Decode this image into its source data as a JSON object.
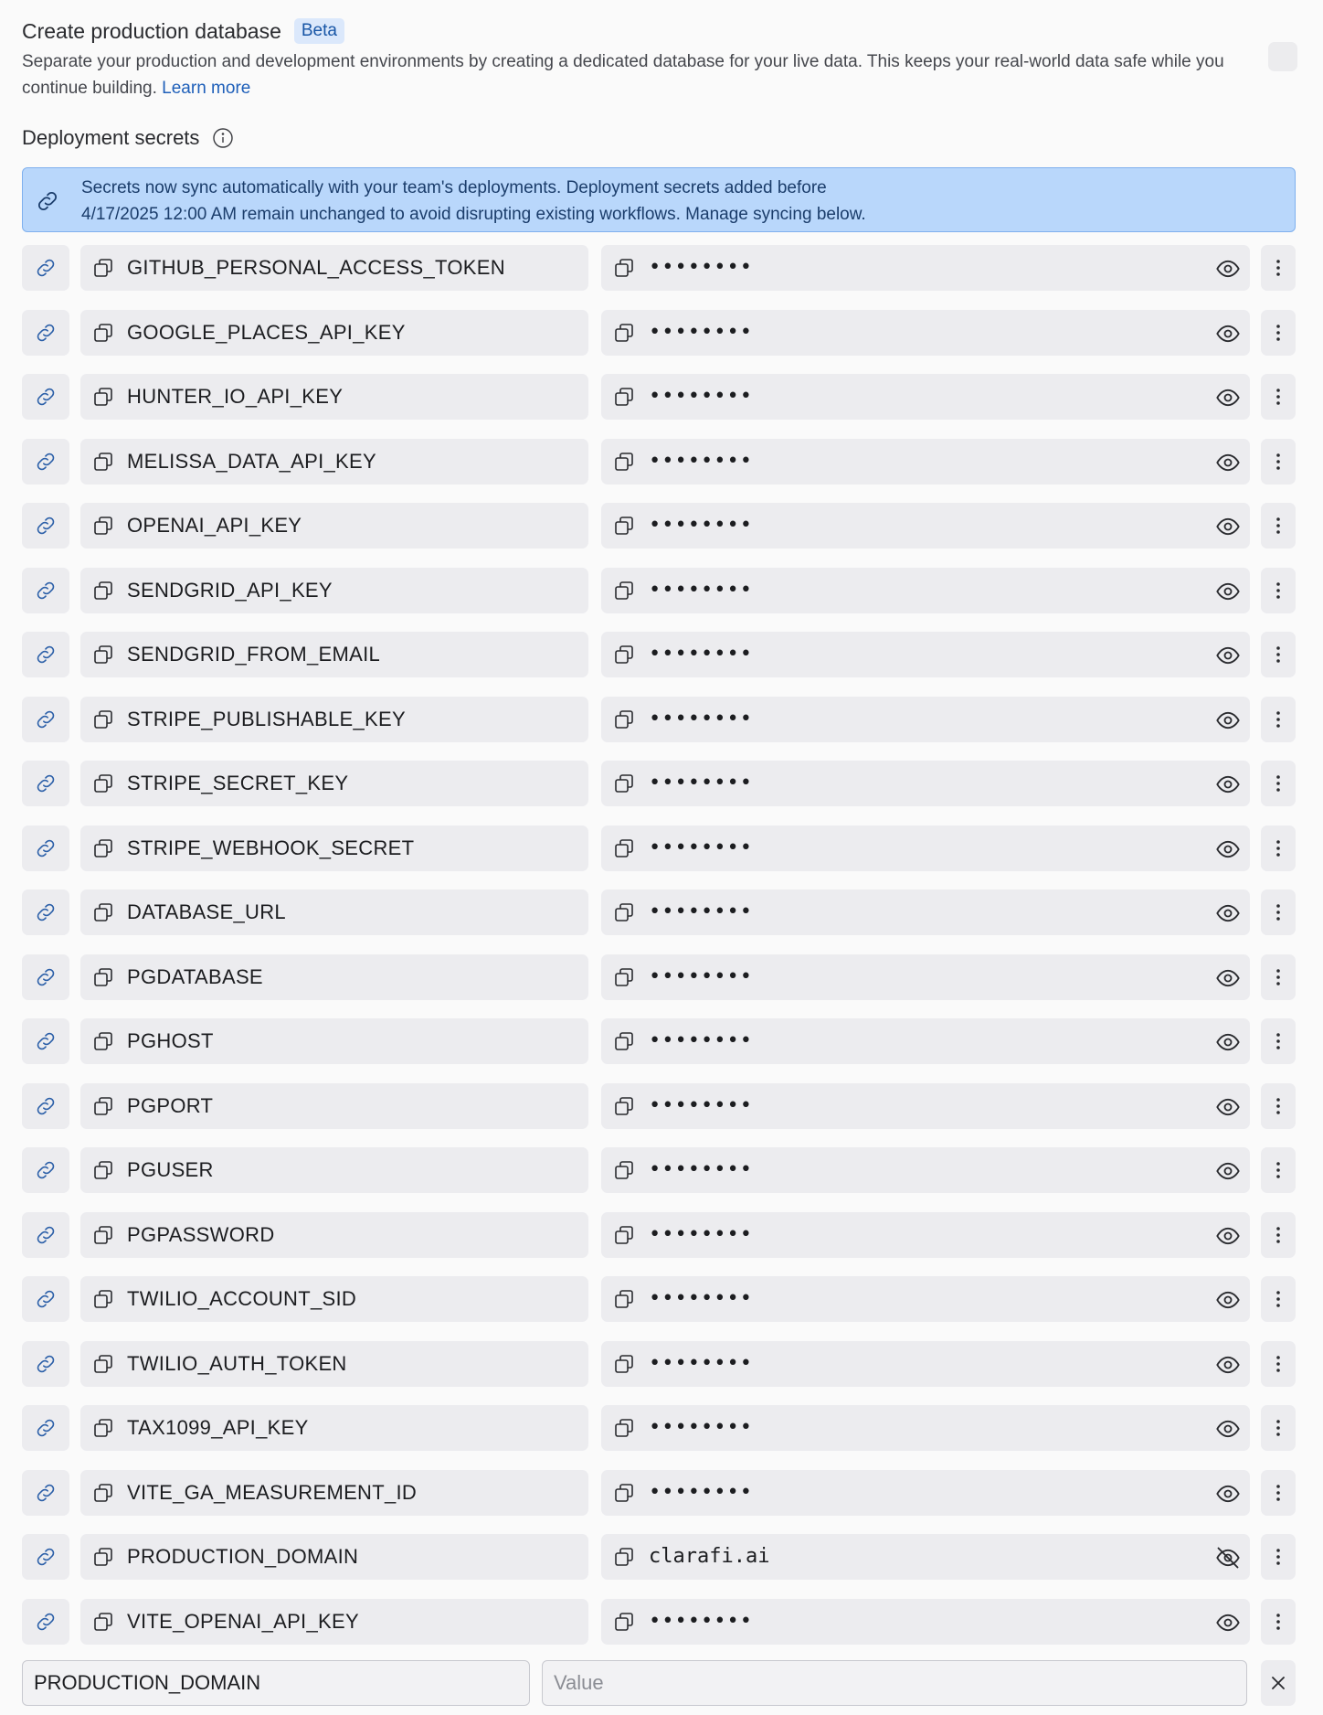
{
  "production_db": {
    "title": "Create production database",
    "badge": "Beta",
    "description": "Separate your production and development environments by creating a dedicated database for your live data. This keeps your real-world data safe while you continue building.",
    "learn_more": "Learn more"
  },
  "secrets_section": {
    "title": "Deployment secrets",
    "banner_line1": "Secrets now sync automatically with your team's deployments. Deployment secrets added before",
    "banner_line2": "4/17/2025 12:00 AM remain unchanged to avoid disrupting existing workflows. Manage syncing below."
  },
  "secrets": [
    {
      "key": "GITHUB_PERSONAL_ACCESS_TOKEN",
      "value": "••••••••",
      "revealed": false
    },
    {
      "key": "GOOGLE_PLACES_API_KEY",
      "value": "••••••••",
      "revealed": false
    },
    {
      "key": "HUNTER_IO_API_KEY",
      "value": "••••••••",
      "revealed": false
    },
    {
      "key": "MELISSA_DATA_API_KEY",
      "value": "••••••••",
      "revealed": false
    },
    {
      "key": "OPENAI_API_KEY",
      "value": "••••••••",
      "revealed": false
    },
    {
      "key": "SENDGRID_API_KEY",
      "value": "••••••••",
      "revealed": false
    },
    {
      "key": "SENDGRID_FROM_EMAIL",
      "value": "••••••••",
      "revealed": false
    },
    {
      "key": "STRIPE_PUBLISHABLE_KEY",
      "value": "••••••••",
      "revealed": false
    },
    {
      "key": "STRIPE_SECRET_KEY",
      "value": "••••••••",
      "revealed": false
    },
    {
      "key": "STRIPE_WEBHOOK_SECRET",
      "value": "••••••••",
      "revealed": false
    },
    {
      "key": "DATABASE_URL",
      "value": "••••••••",
      "revealed": false
    },
    {
      "key": "PGDATABASE",
      "value": "••••••••",
      "revealed": false
    },
    {
      "key": "PGHOST",
      "value": "••••••••",
      "revealed": false
    },
    {
      "key": "PGPORT",
      "value": "••••••••",
      "revealed": false
    },
    {
      "key": "PGUSER",
      "value": "••••••••",
      "revealed": false
    },
    {
      "key": "PGPASSWORD",
      "value": "••••••••",
      "revealed": false
    },
    {
      "key": "TWILIO_ACCOUNT_SID",
      "value": "••••••••",
      "revealed": false
    },
    {
      "key": "TWILIO_AUTH_TOKEN",
      "value": "••••••••",
      "revealed": false
    },
    {
      "key": "TAX1099_API_KEY",
      "value": "••••••••",
      "revealed": false
    },
    {
      "key": "VITE_GA_MEASUREMENT_ID",
      "value": "••••••••",
      "revealed": false
    },
    {
      "key": "PRODUCTION_DOMAIN",
      "value": "clarafi.ai",
      "revealed": true
    },
    {
      "key": "VITE_OPENAI_API_KEY",
      "value": "••••••••",
      "revealed": false
    }
  ],
  "new_secret": {
    "key_value": "PRODUCTION_DOMAIN",
    "value_placeholder": "Value"
  },
  "icons": {
    "link": "link-icon",
    "copy": "copy-icon",
    "show": "eye-icon",
    "hide": "eye-off-icon",
    "more": "more-vertical-icon",
    "info": "info-icon",
    "close": "close-icon"
  },
  "colors": {
    "accent_link": "#1e5fb9",
    "banner_bg": "#b9d7fb",
    "badge_bg": "#dbe8fb",
    "field_bg": "#ececef"
  }
}
